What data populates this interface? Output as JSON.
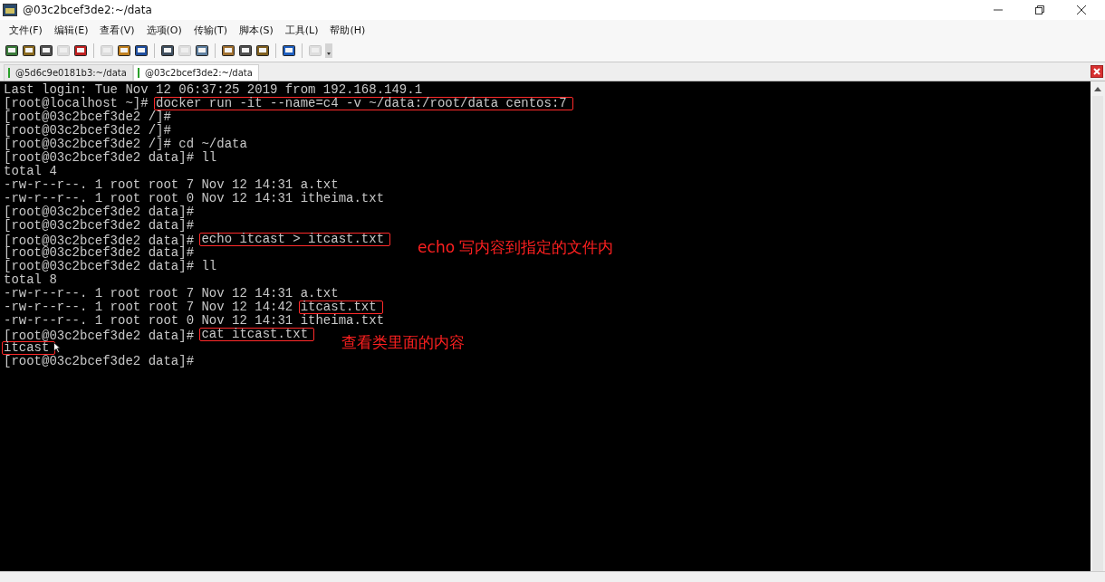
{
  "window": {
    "title": "@03c2bcef3de2:~/data"
  },
  "menu": [
    "文件(F)",
    "编辑(E)",
    "查看(V)",
    "选项(O)",
    "传输(T)",
    "脚本(S)",
    "工具(L)",
    "帮助(H)"
  ],
  "toolbar": [
    {
      "disabled": false
    },
    {
      "disabled": false
    },
    {
      "disabled": false
    },
    {
      "disabled": true
    },
    {
      "disabled": false
    },
    {
      "disabled": true
    },
    {
      "disabled": false
    },
    {
      "disabled": false
    },
    {
      "disabled": false
    },
    {
      "disabled": true
    },
    {
      "disabled": false
    },
    {
      "disabled": false
    },
    {
      "disabled": false
    },
    {
      "disabled": false
    },
    {
      "disabled": false
    },
    {
      "disabled": true
    }
  ],
  "tabs": [
    {
      "label": "@5d6c9e0181b3:~/data",
      "selected": false
    },
    {
      "label": "@03c2bcef3de2:~/data",
      "selected": true
    }
  ],
  "terminal": {
    "lines": [
      {
        "segments": [
          {
            "text": "Last login: Tue Nov 12 06:37:25 2019 from 192.168.149.1",
            "boxed": false
          }
        ]
      },
      {
        "segments": [
          {
            "text": "[root@localhost ~]# ",
            "boxed": false
          },
          {
            "text": "docker run -it --name=c4 -v ~/data:/root/data centos:7",
            "boxed": true
          }
        ]
      },
      {
        "segments": [
          {
            "text": "[root@03c2bcef3de2 /]#",
            "boxed": false
          }
        ]
      },
      {
        "segments": [
          {
            "text": "[root@03c2bcef3de2 /]#",
            "boxed": false
          }
        ]
      },
      {
        "segments": [
          {
            "text": "[root@03c2bcef3de2 /]# cd ~/data",
            "boxed": false
          }
        ]
      },
      {
        "segments": [
          {
            "text": "[root@03c2bcef3de2 data]# ll",
            "boxed": false
          }
        ]
      },
      {
        "segments": [
          {
            "text": "total 4",
            "boxed": false
          }
        ]
      },
      {
        "segments": [
          {
            "text": "-rw-r--r--. 1 root root 7 Nov 12 14:31 a.txt",
            "boxed": false
          }
        ]
      },
      {
        "segments": [
          {
            "text": "-rw-r--r--. 1 root root 0 Nov 12 14:31 itheima.txt",
            "boxed": false
          }
        ]
      },
      {
        "segments": [
          {
            "text": "[root@03c2bcef3de2 data]#",
            "boxed": false
          }
        ]
      },
      {
        "segments": [
          {
            "text": "[root@03c2bcef3de2 data]#",
            "boxed": false
          }
        ]
      },
      {
        "segments": [
          {
            "text": "[root@03c2bcef3de2 data]# ",
            "boxed": false
          },
          {
            "text": "echo itcast > itcast.txt",
            "boxed": true
          }
        ],
        "note": "echo 写内容到指定的文件内"
      },
      {
        "segments": [
          {
            "text": "[root@03c2bcef3de2 data]#",
            "boxed": false
          }
        ]
      },
      {
        "segments": [
          {
            "text": "[root@03c2bcef3de2 data]# ll",
            "boxed": false
          }
        ]
      },
      {
        "segments": [
          {
            "text": "total 8",
            "boxed": false
          }
        ]
      },
      {
        "segments": [
          {
            "text": "-rw-r--r--. 1 root root 7 Nov 12 14:31 a.txt",
            "boxed": false
          }
        ]
      },
      {
        "segments": [
          {
            "text": "-rw-r--r--. 1 root root 7 Nov 12 14:42 ",
            "boxed": false
          },
          {
            "text": "itcast.txt",
            "boxed": true
          }
        ]
      },
      {
        "segments": [
          {
            "text": "-rw-r--r--. 1 root root 0 Nov 12 14:31 itheima.txt",
            "boxed": false
          }
        ]
      },
      {
        "segments": [
          {
            "text": "[root@03c2bcef3de2 data]# ",
            "boxed": false
          },
          {
            "text": "cat itcast.txt",
            "boxed": true
          }
        ],
        "note": "查看类里面的内容"
      },
      {
        "segments": [
          {
            "text": "itcast",
            "boxed": true
          }
        ],
        "pointer": true
      },
      {
        "segments": [
          {
            "text": "[root@03c2bcef3de2 data]#",
            "boxed": false
          }
        ]
      }
    ]
  }
}
